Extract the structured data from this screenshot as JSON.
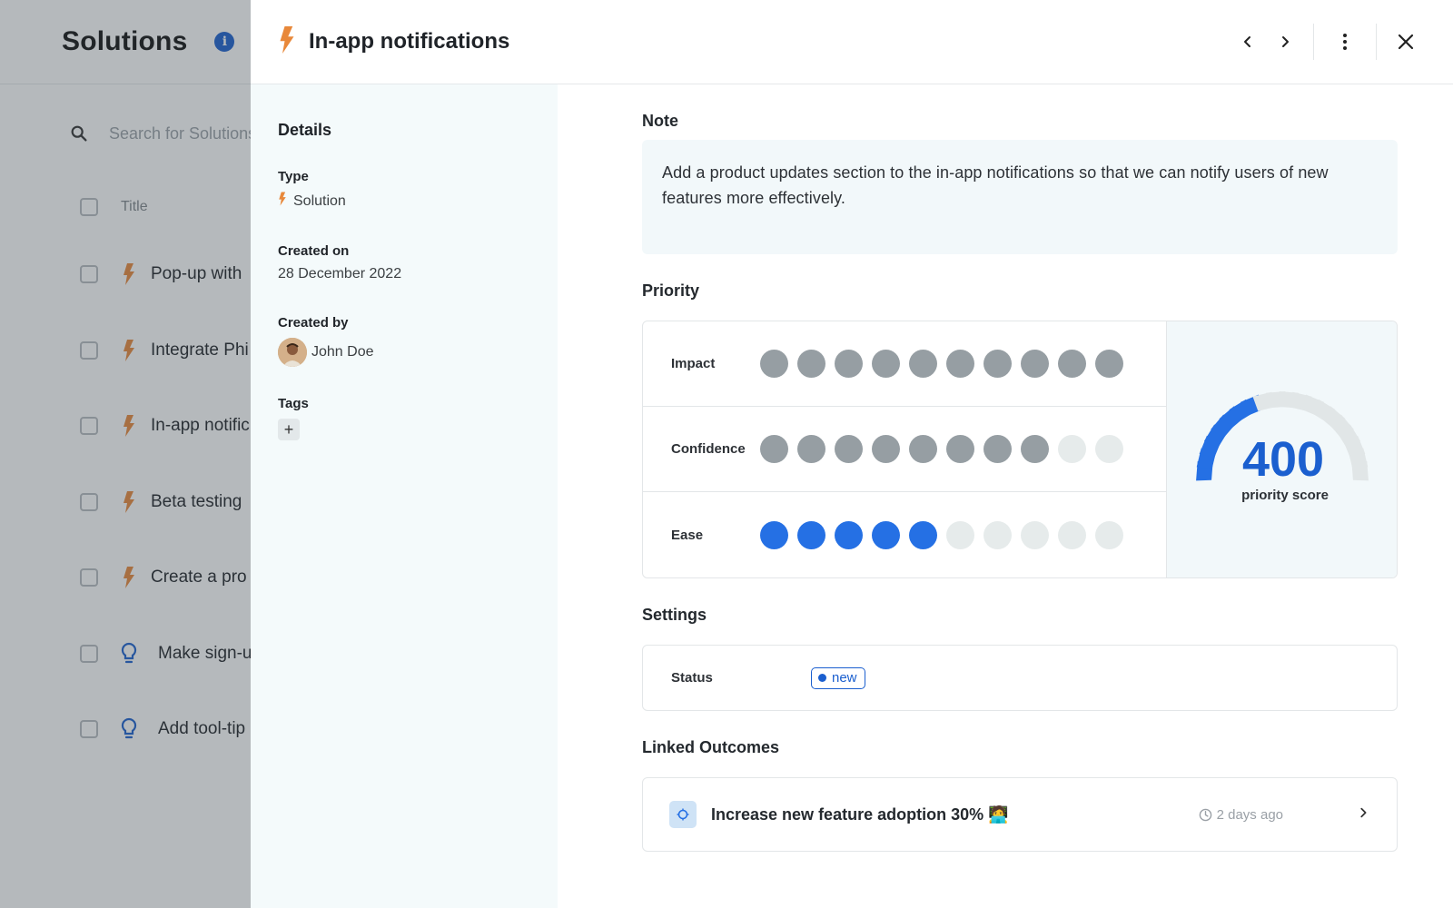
{
  "background": {
    "title": "Solutions",
    "info_icon": "info-icon",
    "search_placeholder": "Search for Solutions",
    "column_title": "Title",
    "rows": [
      {
        "icon": "bolt-icon",
        "title": "Pop-up with"
      },
      {
        "icon": "bolt-icon",
        "title": "Integrate Phi"
      },
      {
        "icon": "bolt-icon",
        "title": "In-app notific"
      },
      {
        "icon": "bolt-icon",
        "title": "Beta testing"
      },
      {
        "icon": "bolt-icon",
        "title": "Create a pro"
      },
      {
        "icon": "lightbulb-icon",
        "title": "Make sign-u"
      },
      {
        "icon": "lightbulb-icon",
        "title": "Add tool-tip"
      }
    ]
  },
  "panel": {
    "title": "In-app notifications",
    "title_icon": "bolt-icon",
    "actions": [
      "chevron-left-icon",
      "chevron-right-icon",
      "more-vertical-icon",
      "close-icon"
    ],
    "details": {
      "heading": "Details",
      "type_label": "Type",
      "type_value": "Solution",
      "created_on_label": "Created on",
      "created_on_value": "28 December 2022",
      "created_by_label": "Created by",
      "created_by_value": "John Doe",
      "tags_label": "Tags",
      "add_tag": "+"
    },
    "note": {
      "heading": "Note",
      "text": "Add a product updates section to the in-app notifications so that we can notify users of new features more effectively."
    },
    "priority": {
      "heading": "Priority",
      "rows": [
        {
          "label": "Impact",
          "value": 10,
          "max": 10,
          "color": "#969ea3"
        },
        {
          "label": "Confidence",
          "value": 8,
          "max": 10,
          "color": "#969ea3"
        },
        {
          "label": "Ease",
          "value": 5,
          "max": 10,
          "color": "#2570e4"
        }
      ],
      "score": "400",
      "score_label": "priority score",
      "gauge_fill_fraction": 0.4,
      "gauge_color": "#2570e4"
    },
    "settings": {
      "heading": "Settings",
      "status_label": "Status",
      "status_value": "new"
    },
    "linked_outcomes": {
      "heading": "Linked Outcomes",
      "items": [
        {
          "title": "Increase new feature adoption 30% 🧑‍💻",
          "time": "2 days ago"
        }
      ]
    }
  }
}
